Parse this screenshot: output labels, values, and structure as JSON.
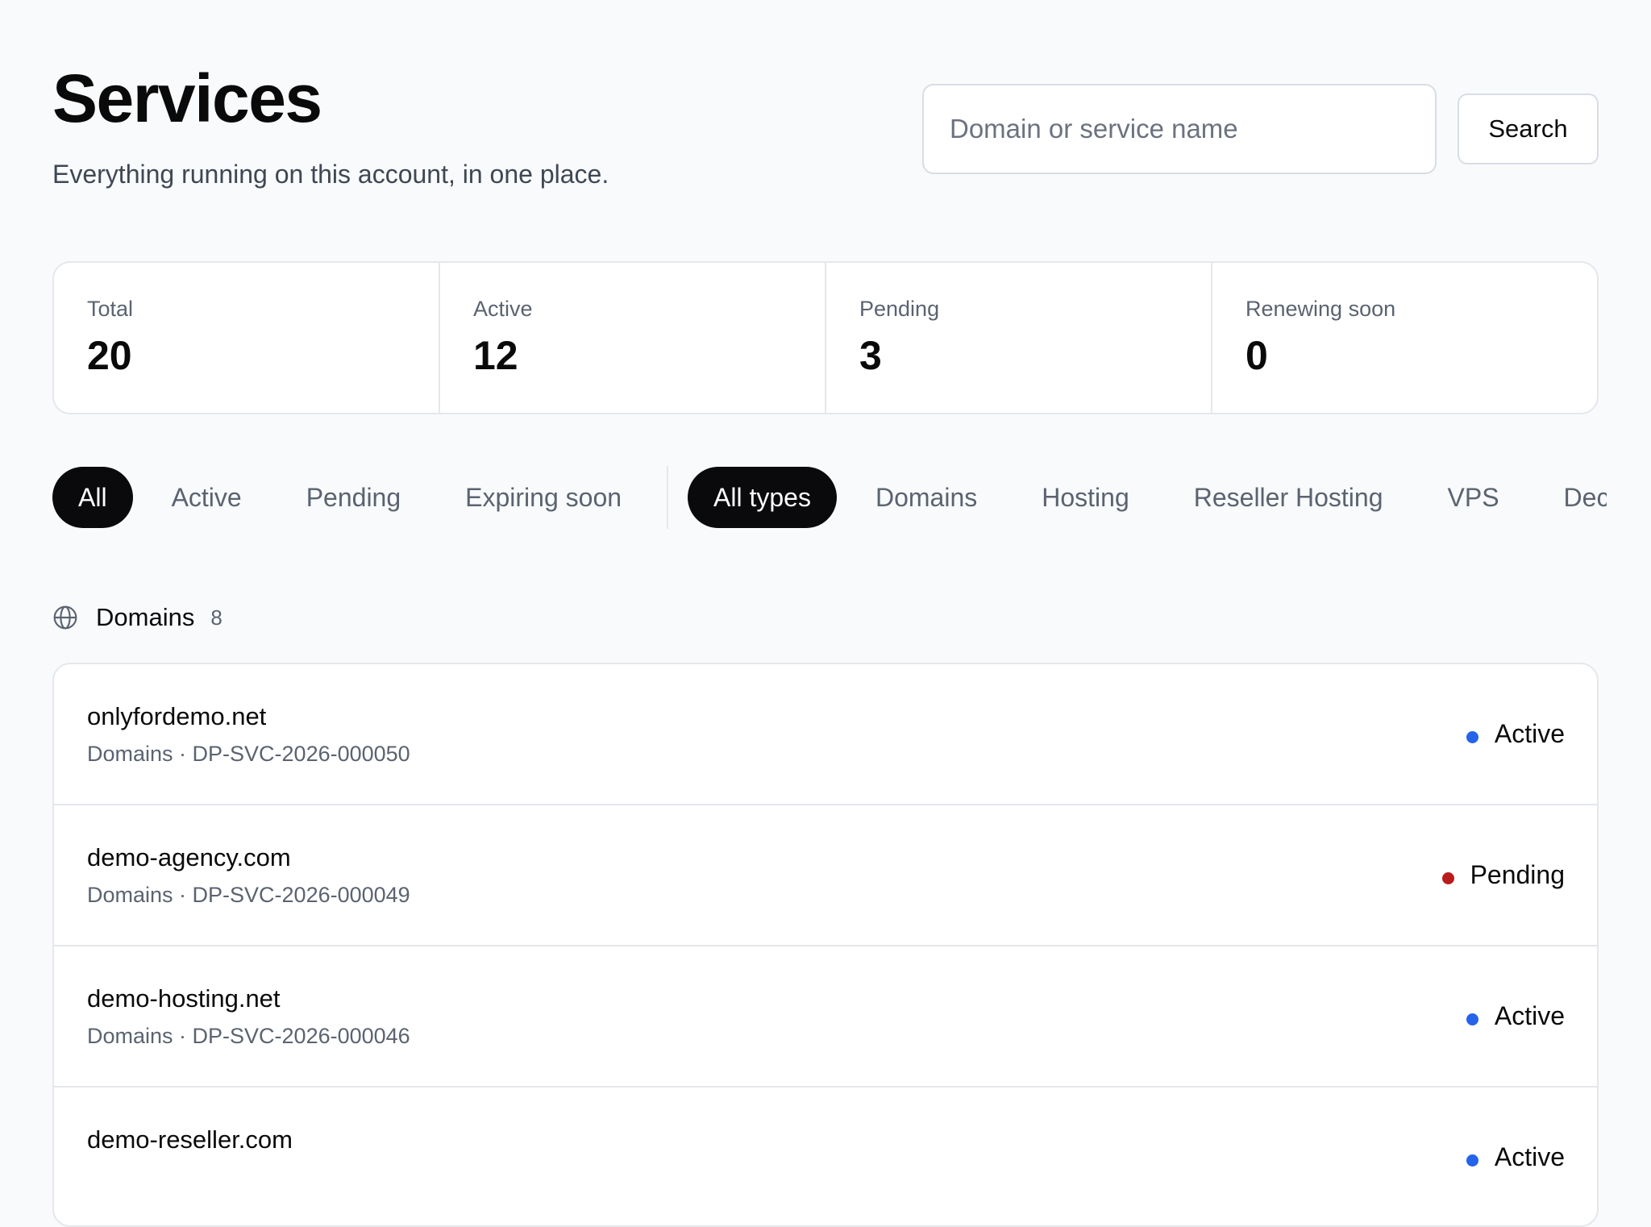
{
  "header": {
    "title": "Services",
    "subtitle": "Everything running on this account, in one place."
  },
  "search": {
    "placeholder": "Domain or service name",
    "value": "",
    "button_label": "Search"
  },
  "stats": [
    {
      "label": "Total",
      "value": "20"
    },
    {
      "label": "Active",
      "value": "12"
    },
    {
      "label": "Pending",
      "value": "3"
    },
    {
      "label": "Renewing soon",
      "value": "0"
    }
  ],
  "status_filters": [
    {
      "label": "All",
      "active": true
    },
    {
      "label": "Active",
      "active": false
    },
    {
      "label": "Pending",
      "active": false
    },
    {
      "label": "Expiring soon",
      "active": false
    }
  ],
  "type_filters": [
    {
      "label": "All types",
      "active": true
    },
    {
      "label": "Domains",
      "active": false
    },
    {
      "label": "Hosting",
      "active": false
    },
    {
      "label": "Reseller Hosting",
      "active": false
    },
    {
      "label": "VPS",
      "active": false
    },
    {
      "label": "Dec",
      "active": false
    }
  ],
  "section": {
    "icon": "globe-icon",
    "title": "Domains",
    "count": "8"
  },
  "colors": {
    "active_status": "#2563eb",
    "pending_status": "#b91c1c",
    "pill_active_bg": "#0a0a0d"
  },
  "services": [
    {
      "name": "onlyfordemo.net",
      "meta": "Domains · DP-SVC-2026-000050",
      "status": "Active",
      "status_color": "#2563eb"
    },
    {
      "name": "demo-agency.com",
      "meta": "Domains · DP-SVC-2026-000049",
      "status": "Pending",
      "status_color": "#b91c1c"
    },
    {
      "name": "demo-hosting.net",
      "meta": "Domains · DP-SVC-2026-000046",
      "status": "Active",
      "status_color": "#2563eb"
    },
    {
      "name": "demo-reseller.com",
      "meta": "",
      "status": "Active",
      "status_color": "#2563eb"
    }
  ]
}
